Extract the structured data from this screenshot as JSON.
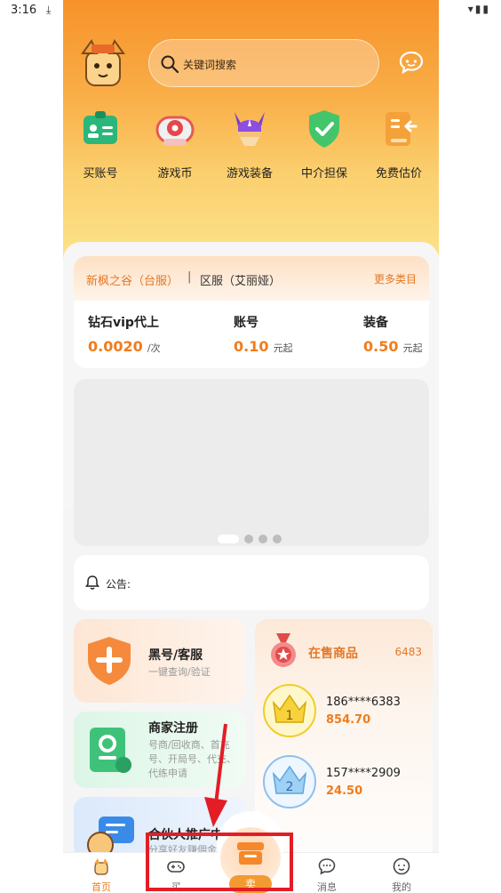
{
  "statusbar": {
    "time": "3:16"
  },
  "header": {
    "search_placeholder": "关键词搜索"
  },
  "categories": [
    {
      "label": "买账号",
      "icon": "id-card-icon"
    },
    {
      "label": "游戏币",
      "icon": "game-coin-icon"
    },
    {
      "label": "游戏装备",
      "icon": "helmet-icon"
    },
    {
      "label": "中介担保",
      "icon": "shield-check-icon"
    },
    {
      "label": "免费估价",
      "icon": "estimate-icon"
    }
  ],
  "server": {
    "server_name": "新枫之谷（台服）",
    "divider": "|",
    "region": "区服（艾丽娅）",
    "more": "更多类目",
    "prices": [
      {
        "title": "钻石vip代上",
        "value": "0.0020",
        "unit": "/次"
      },
      {
        "title": "账号",
        "value": "0.10",
        "unit": "元起"
      },
      {
        "title": "装备",
        "value": "0.50",
        "unit": "元起"
      }
    ]
  },
  "banner": {
    "dots_total": 4,
    "active_index": 0
  },
  "notice": {
    "label": "公告:"
  },
  "features": [
    {
      "title": "黑号/客服",
      "subtitle": "一键查询/验证"
    },
    {
      "title": "商家注册",
      "subtitle": "号商/回收商、首充号、开局号、代充、代练申请"
    },
    {
      "title": "合伙人推广中",
      "subtitle": "分享好友赚佣金"
    }
  ],
  "onsale": {
    "title": "在售商品",
    "count": "6483",
    "rows": [
      {
        "rank": "1",
        "seller": "186****6383",
        "amount": "854.70"
      },
      {
        "rank": "2",
        "seller": "157****2909",
        "amount": "24.50"
      }
    ]
  },
  "tabbar": {
    "home": "首页",
    "buy": "买",
    "sell": "卖",
    "messages": "消息",
    "mine": "我的"
  },
  "colors": {
    "accent": "#f07c1c",
    "annotation": "#e31d25"
  }
}
